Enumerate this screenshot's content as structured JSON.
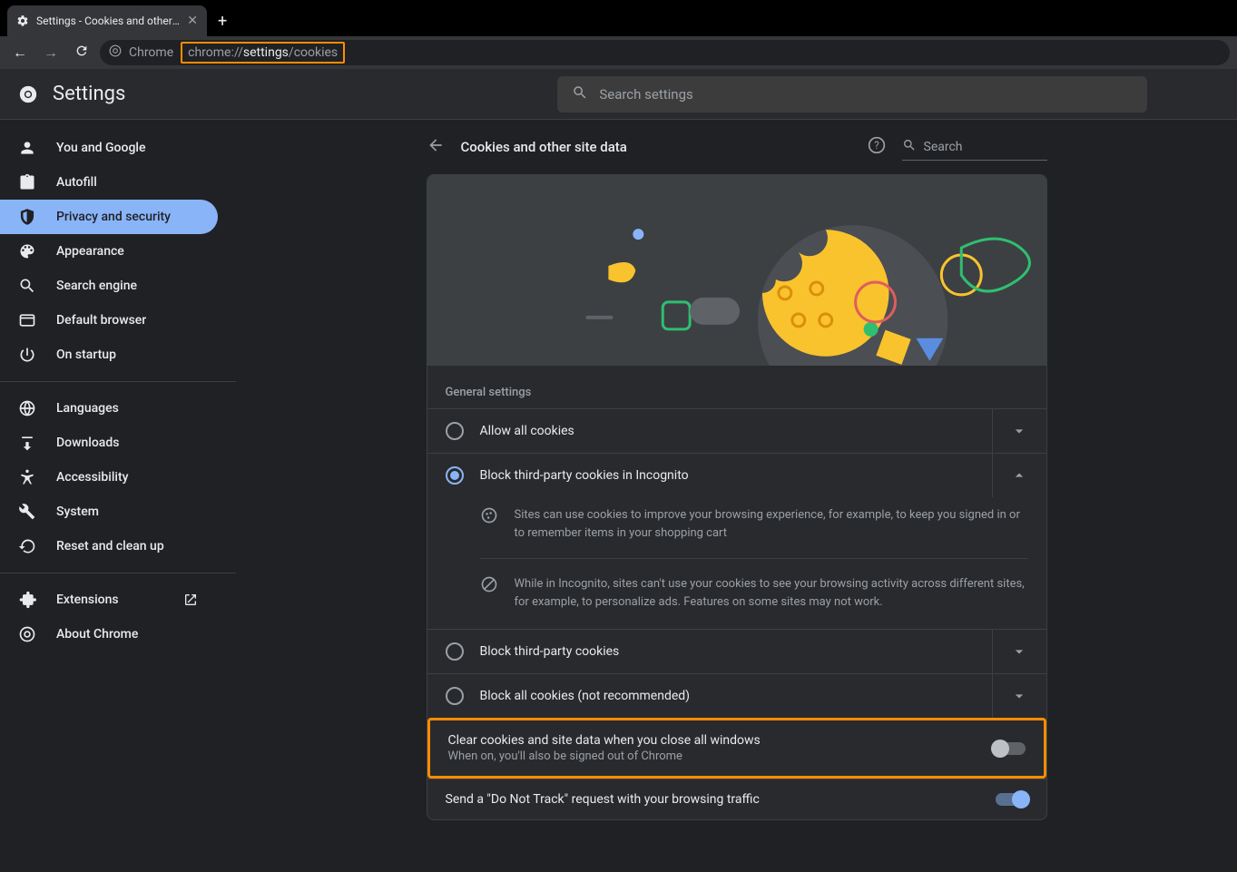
{
  "browser": {
    "tab_title": "Settings - Cookies and other site",
    "chrome_label": "Chrome",
    "url_pre": "chrome://",
    "url_mid": "settings",
    "url_post": "/cookies"
  },
  "header": {
    "title": "Settings",
    "search_placeholder": "Search settings"
  },
  "sidebar": {
    "items": [
      {
        "label": "You and Google"
      },
      {
        "label": "Autofill"
      },
      {
        "label": "Privacy and security"
      },
      {
        "label": "Appearance"
      },
      {
        "label": "Search engine"
      },
      {
        "label": "Default browser"
      },
      {
        "label": "On startup"
      }
    ],
    "items2": [
      {
        "label": "Languages"
      },
      {
        "label": "Downloads"
      },
      {
        "label": "Accessibility"
      },
      {
        "label": "System"
      },
      {
        "label": "Reset and clean up"
      }
    ],
    "items3": [
      {
        "label": "Extensions"
      },
      {
        "label": "About Chrome"
      }
    ]
  },
  "page": {
    "title": "Cookies and other site data",
    "search_placeholder": "Search",
    "section_label": "General settings",
    "radios": [
      {
        "label": "Allow all cookies"
      },
      {
        "label": "Block third-party cookies in Incognito"
      },
      {
        "label": "Block third-party cookies"
      },
      {
        "label": "Block all cookies (not recommended)"
      }
    ],
    "info1": "Sites can use cookies to improve your browsing experience, for example, to keep you signed in or to remember items in your shopping cart",
    "info2": "While in Incognito, sites can't use your cookies to see your browsing activity across different sites, for example, to personalize ads. Features on some sites may not work.",
    "clear_label": "Clear cookies and site data when you close all windows",
    "clear_sub": "When on, you'll also be signed out of Chrome",
    "dnt_label": "Send a \"Do Not Track\" request with your browsing traffic"
  }
}
